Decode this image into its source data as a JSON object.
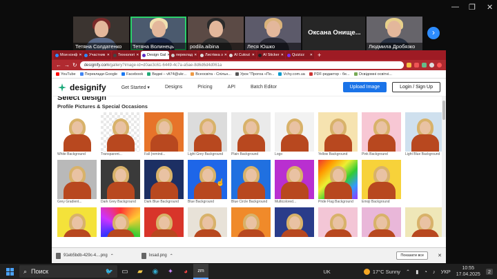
{
  "zoom": {
    "participants": [
      {
        "name": "Тетяна Солдатенко",
        "hair": "#7a2a2a",
        "body": "#5a6a8a",
        "bg": "#3b3430",
        "active": false
      },
      {
        "name": "Тетяна Волинець",
        "hair": "#f0e0b0",
        "body": "#1e2a4a",
        "bg": "#4b5a6e",
        "active": true
      },
      {
        "name": "podila.aibina",
        "hair": "#2b2b2b",
        "body": "#333",
        "bg": "#5b4a45",
        "active": false
      },
      {
        "name": "Леся Юшко",
        "hair": "#d9b27a",
        "body": "#2e2e3a",
        "bg": "#5c5a6a",
        "active": false
      }
    ],
    "text_tile": {
      "big": "Оксана  Онище...",
      "name": "Оксана Онищенко"
    },
    "last_tile": {
      "name": "Людмила Дробязко",
      "hair": "#e7d08a",
      "body": "#2a3344",
      "bg": "#66646a"
    },
    "next_icon": "›"
  },
  "browser": {
    "tabs": [
      {
        "label": "Мои конф",
        "color": "#2d8cff"
      },
      {
        "label": "Участник",
        "color": "#2d8cff"
      },
      {
        "label": "Технологі",
        "color": "#444"
      },
      {
        "label": "Design Gal",
        "color": "#5a2bc4",
        "active": true
      },
      {
        "label": "переклад",
        "color": "#ccc"
      },
      {
        "label": "Листівка з",
        "color": "#ddd"
      },
      {
        "label": "AI Cutout",
        "color": "#ddd"
      },
      {
        "label": "AI Sticker",
        "color": "#222"
      },
      {
        "label": "Quizizz",
        "color": "#7b2cf2"
      }
    ],
    "new_tab": "+",
    "url_main": "designify.com",
    "url_rest": "/gallery?image-id=d0ae3c61-6449-4c7a-a5ae-8d6d6d4d061a",
    "bookmarks": [
      {
        "label": "YouTube",
        "color": "#ff0000"
      },
      {
        "label": "Переклади Google",
        "color": "#4285f4"
      },
      {
        "label": "Facebook",
        "color": "#1877f2"
      },
      {
        "label": "Ведмі – vlt74@ukr...",
        "color": "#2a7"
      },
      {
        "label": "Всеосвіта - Спільн...",
        "color": "#e94"
      },
      {
        "label": "Урок \"Прогоа «По...",
        "color": "#555"
      },
      {
        "label": "Vchy.com.ua",
        "color": "#09c"
      },
      {
        "label": "PDF-редактор - бе...",
        "color": "#c33"
      },
      {
        "label": "Освідомні освітні...",
        "color": "#7a5"
      }
    ]
  },
  "site": {
    "logo": "designify",
    "nav": [
      {
        "label": "Get Started ▾"
      },
      {
        "label": "Designs"
      },
      {
        "label": "Pricing"
      },
      {
        "label": "API"
      },
      {
        "label": "Batch Editor"
      }
    ],
    "upload": "Upload Image",
    "login": "Login / Sign Up",
    "cut_heading": "Select design",
    "section_title": "Profile Pictures & Special Occasions",
    "rows": [
      [
        {
          "caption": "White Background",
          "bg": "#ffffff"
        },
        {
          "caption": "Transparent...",
          "bg": "checker"
        },
        {
          "caption": "Fall (remind...",
          "bg": "#e7742a"
        },
        {
          "caption": "Light Grey Background",
          "bg": "#dcdcdc"
        },
        {
          "caption": "Plain Background",
          "bg": "#eaeaea"
        },
        {
          "caption": "Logo",
          "bg": "#f2f2f2"
        },
        {
          "caption": "Yellow Background",
          "bg": "#f6e3b0"
        },
        {
          "caption": "Pink Background",
          "bg": "#f7c7d4"
        },
        {
          "caption": "Light Blue Background",
          "bg": "#cfe0ee"
        }
      ],
      [
        {
          "caption": "Grey Gradient...",
          "bg": "#b9b9b9"
        },
        {
          "caption": "Dark Grey Background",
          "bg": "#3a3a3a"
        },
        {
          "caption": "Dark Blue Background",
          "bg": "#1c2f63"
        },
        {
          "caption": "Blue Background",
          "bg": "#1e66e8"
        },
        {
          "caption": "Blue Circle Background",
          "bg": "#2070e0"
        },
        {
          "caption": "Multicolored...",
          "bg": "#b92fd0"
        },
        {
          "caption": "Pride Flag Background",
          "bg": "rainbow"
        },
        {
          "caption": "Emoji Background",
          "bg": "#f7d23a"
        }
      ],
      [
        {
          "caption": "",
          "bg": "#f4e23a"
        },
        {
          "caption": "",
          "bg": "ring"
        },
        {
          "caption": "",
          "bg": "#d8352a"
        },
        {
          "caption": "",
          "bg": "#e8e2d8"
        },
        {
          "caption": "",
          "bg": "#f08a2a"
        },
        {
          "caption": "",
          "bg": "#2a3c8a"
        },
        {
          "caption": "",
          "bg": "#f3c6d6"
        },
        {
          "caption": "",
          "bg": "#e9b7d9"
        },
        {
          "caption": "",
          "bg": "#efe7b8"
        }
      ]
    ]
  },
  "downloads": {
    "items": [
      {
        "name": "91eb5bdb-429c-4....png"
      },
      {
        "name": "Ixsad.png"
      }
    ],
    "show_all": "Показати все",
    "close": "✕"
  },
  "taskbar": {
    "search": "Поиск",
    "lang": "UK",
    "weather": "17°C  Sunny",
    "keyboard": "УКР",
    "time": "10:55",
    "date": "17.04.2025",
    "notif": "2"
  }
}
